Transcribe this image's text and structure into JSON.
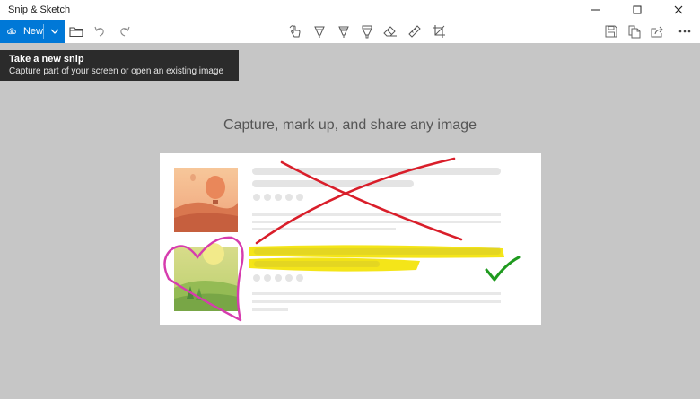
{
  "window": {
    "title": "Snip & Sketch",
    "minimize_icon": "minimize-icon",
    "maximize_icon": "maximize-icon",
    "close_icon": "close-icon"
  },
  "toolbar": {
    "new_label": "New",
    "new_icon": "snip-cloud-icon",
    "new_dropdown_icon": "chevron-down-icon",
    "left_icons": [
      "open-folder-icon",
      "undo-icon",
      "redo-icon"
    ],
    "center_icons": [
      "touch-writing-icon",
      "ballpoint-pen-icon",
      "pencil-icon",
      "highlighter-icon",
      "eraser-icon",
      "ruler-icon",
      "crop-icon"
    ],
    "right_icons": [
      "save-icon",
      "copy-icon",
      "share-icon",
      "more-options-icon"
    ]
  },
  "tooltip": {
    "title": "Take a new snip",
    "description": "Capture part of your screen or open an existing image"
  },
  "main": {
    "headline": "Capture, mark up, and share any image"
  },
  "colors": {
    "accent": "#0078d7",
    "canvas_bg": "#c6c6c6",
    "tooltip_bg": "#2b2b2b",
    "markup_red": "#d91e2a",
    "markup_yellow": "#f3e200",
    "markup_green": "#1f9a1f",
    "markup_pink": "#d63cae"
  }
}
